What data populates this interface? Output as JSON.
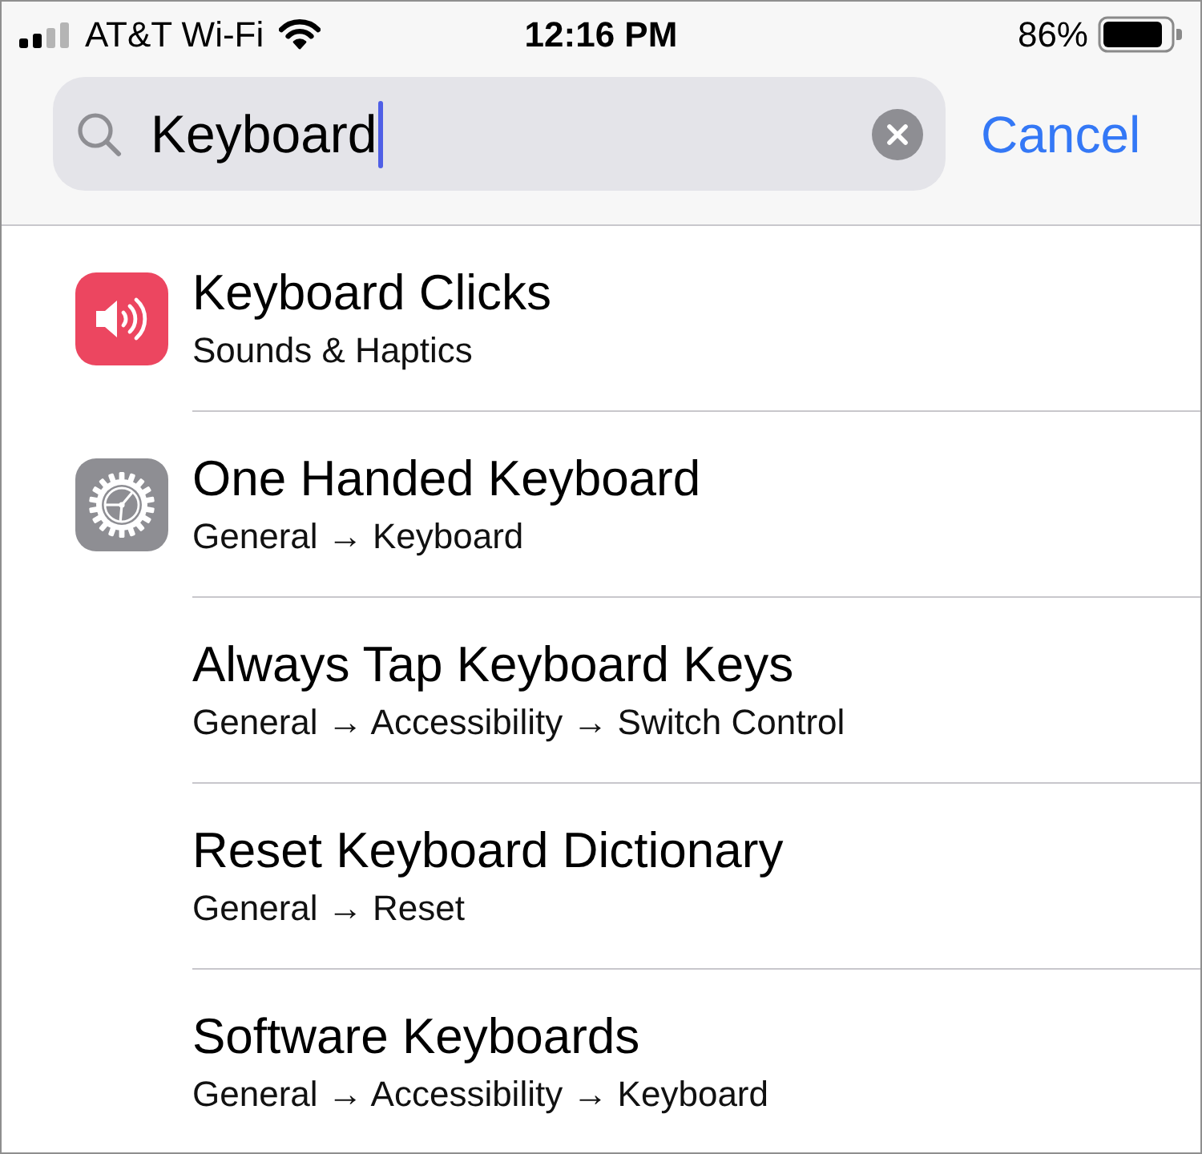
{
  "status_bar": {
    "carrier": "AT&T Wi-Fi",
    "time": "12:16 PM",
    "battery": "86%"
  },
  "search": {
    "value": "Keyboard",
    "focused": true,
    "cancel": "Cancel"
  },
  "results": [
    {
      "kind": "sound",
      "title": "Keyboard Clicks",
      "path": "Sounds & Haptics"
    },
    {
      "kind": "gear",
      "title": "One Handed Keyboard",
      "path": "General → Keyboard"
    },
    {
      "kind": "plain",
      "title": "Always Tap Keyboard Keys",
      "path": "General → Accessibility → Switch Control"
    },
    {
      "kind": "plain",
      "title": "Reset Keyboard Dictionary",
      "path": "General → Reset"
    },
    {
      "kind": "plain",
      "title": "Software Keyboards",
      "path": "General → Accessibility → Keyboard"
    }
  ]
}
